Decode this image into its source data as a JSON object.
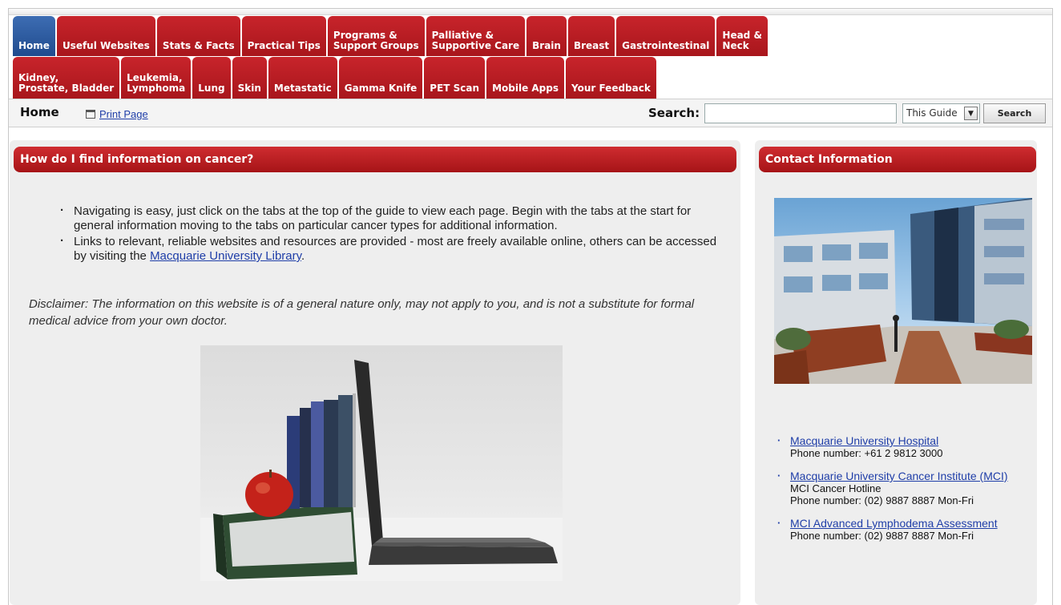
{
  "tabs_row1": [
    {
      "label": "Home",
      "active": true
    },
    {
      "label": "Useful Websites"
    },
    {
      "label": "Stats & Facts"
    },
    {
      "label": "Practical Tips"
    },
    {
      "label": "Programs &\nSupport Groups"
    },
    {
      "label": "Palliative &\nSupportive Care"
    },
    {
      "label": "Brain"
    },
    {
      "label": "Breast"
    },
    {
      "label": "Gastrointestinal"
    },
    {
      "label": "Head &\nNeck"
    }
  ],
  "tabs_row2": [
    {
      "label": "Kidney,\nProstate, Bladder"
    },
    {
      "label": "Leukemia,\nLymphoma"
    },
    {
      "label": "Lung"
    },
    {
      "label": "Skin"
    },
    {
      "label": "Metastatic"
    },
    {
      "label": "Gamma Knife"
    },
    {
      "label": "PET Scan"
    },
    {
      "label": "Mobile Apps"
    },
    {
      "label": "Your Feedback"
    }
  ],
  "breadcrumb": {
    "current": "Home",
    "print_label": "Print Page"
  },
  "search": {
    "label": "Search:",
    "value": "",
    "scope": "This Guide",
    "button": "Search"
  },
  "main": {
    "heading": "How do I find information on cancer?",
    "bullet1": "Navigating is easy, just click on the tabs at the top of the guide to view each page. Begin with the tabs at the start for general information moving to the tabs on particular cancer types for additional information.",
    "bullet2_text": "Links to relevant, reliable websites and resources are provided - most are freely available online, others can be accessed by visiting the",
    "bullet2_link": "Macquarie University Library",
    "bullet2_end": ".",
    "disclaimer": "Disclaimer: The information on this website is of a general nature only, may not apply to you, and is not a substitute for formal medical advice from your own doctor."
  },
  "side": {
    "heading": "Contact Information",
    "contacts": [
      {
        "name": "Macquarie University Hospital",
        "lines": [
          "Phone number: +61 2 9812 3000"
        ]
      },
      {
        "name": "Macquarie University Cancer Institute (MCI)",
        "lines": [
          "MCI Cancer Hotline",
          "Phone number: (02) 9887 8887 Mon-Fri"
        ]
      },
      {
        "name": "MCI Advanced Lymphodema Assessment",
        "lines": [
          "Phone number: (02) 9887 8887 Mon-Fri"
        ]
      }
    ]
  },
  "colors": {
    "tab_red": "#b81c22",
    "tab_active_blue": "#2f5ea3",
    "header_red": "#c0201f",
    "link_blue": "#1f3ea8"
  },
  "icons": {
    "print": "printer-icon",
    "select_arrow": "chevron-down-icon"
  }
}
